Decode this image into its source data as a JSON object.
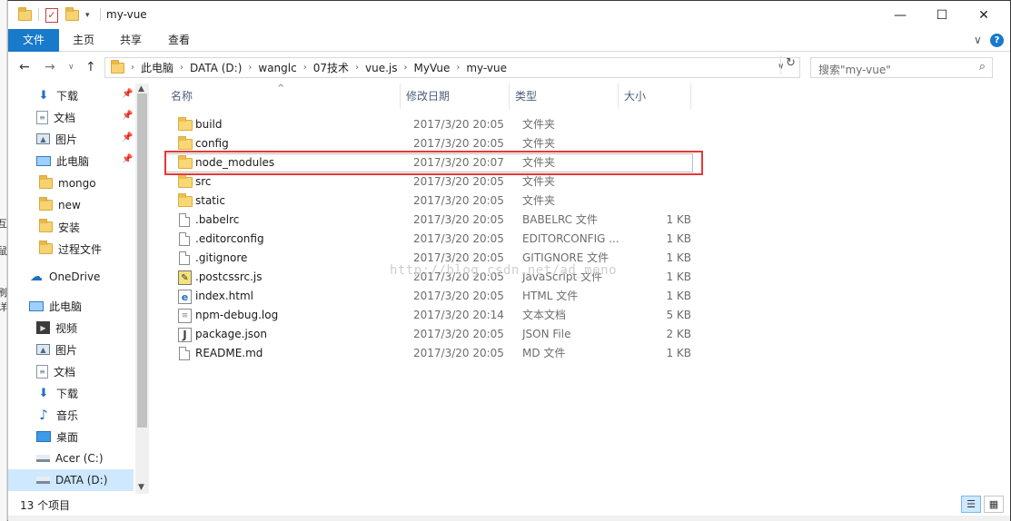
{
  "window": {
    "title": "my-vue"
  },
  "window_controls": {
    "minimize": "—",
    "maximize": "☐",
    "close": "✕"
  },
  "ribbon": {
    "tabs": [
      {
        "label": "文件"
      },
      {
        "label": "主页"
      },
      {
        "label": "共享"
      },
      {
        "label": "查看"
      }
    ],
    "collapse_glyph": "∨",
    "help_glyph": "?"
  },
  "navigation": {
    "back": "←",
    "forward": "→",
    "recent": "∨",
    "up": "↑"
  },
  "address": {
    "crumbs": [
      "此电脑",
      "DATA (D:)",
      "wanglc",
      "07技术",
      "vue.js",
      "MyVue",
      "my-vue"
    ],
    "dropdown_glyph": "∨",
    "refresh_glyph": "↻"
  },
  "search": {
    "placeholder": "搜索\"my-vue\""
  },
  "nav_pane": {
    "items": [
      {
        "label": "下载",
        "icon": "download-icon",
        "pinned": true
      },
      {
        "label": "文档",
        "icon": "document-icon",
        "pinned": true
      },
      {
        "label": "图片",
        "icon": "picture-icon",
        "pinned": true
      },
      {
        "label": "此电脑",
        "icon": "computer-icon",
        "pinned": true
      },
      {
        "label": "mongo",
        "icon": "folder-icon",
        "pinned": false
      },
      {
        "label": "new",
        "icon": "folder-icon",
        "pinned": false
      },
      {
        "label": "安装",
        "icon": "folder-icon",
        "pinned": false
      },
      {
        "label": "过程文件",
        "icon": "folder-icon",
        "pinned": false
      },
      {
        "label": "OneDrive",
        "icon": "cloud-icon",
        "pinned": false
      },
      {
        "label": "此电脑",
        "icon": "computer-icon",
        "pinned": false
      },
      {
        "label": "视频",
        "icon": "video-icon",
        "pinned": false
      },
      {
        "label": "图片",
        "icon": "picture-icon",
        "pinned": false
      },
      {
        "label": "文档",
        "icon": "document-icon",
        "pinned": false
      },
      {
        "label": "下载",
        "icon": "download-icon",
        "pinned": false
      },
      {
        "label": "音乐",
        "icon": "music-icon",
        "pinned": false
      },
      {
        "label": "桌面",
        "icon": "desktop-icon",
        "pinned": false
      },
      {
        "label": "Acer (C:)",
        "icon": "drive-icon",
        "pinned": false
      },
      {
        "label": "DATA (D:)",
        "icon": "drive-icon",
        "pinned": false,
        "selected": true
      }
    ]
  },
  "columns": {
    "name": "名称",
    "date": "修改日期",
    "type": "类型",
    "size": "大小"
  },
  "files": [
    {
      "name": "build",
      "date": "2017/3/20 20:05",
      "type": "文件夹",
      "size": "",
      "icon": "folder-icon"
    },
    {
      "name": "config",
      "date": "2017/3/20 20:05",
      "type": "文件夹",
      "size": "",
      "icon": "folder-icon"
    },
    {
      "name": "node_modules",
      "date": "2017/3/20 20:07",
      "type": "文件夹",
      "size": "",
      "icon": "folder-icon",
      "highlighted": true
    },
    {
      "name": "src",
      "date": "2017/3/20 20:05",
      "type": "文件夹",
      "size": "",
      "icon": "folder-icon"
    },
    {
      "name": "static",
      "date": "2017/3/20 20:05",
      "type": "文件夹",
      "size": "",
      "icon": "folder-icon"
    },
    {
      "name": ".babelrc",
      "date": "2017/3/20 20:05",
      "type": "BABELRC 文件",
      "size": "1 KB",
      "icon": "file-icon"
    },
    {
      "name": ".editorconfig",
      "date": "2017/3/20 20:05",
      "type": "EDITORCONFIG ...",
      "size": "1 KB",
      "icon": "file-icon"
    },
    {
      "name": ".gitignore",
      "date": "2017/3/20 20:05",
      "type": "GITIGNORE 文件",
      "size": "1 KB",
      "icon": "file-icon"
    },
    {
      "name": ".postcssrc.js",
      "date": "2017/3/20 20:05",
      "type": "JavaScript 文件",
      "size": "1 KB",
      "icon": "javascript-icon"
    },
    {
      "name": "index.html",
      "date": "2017/3/20 20:05",
      "type": "HTML 文件",
      "size": "1 KB",
      "icon": "html-icon"
    },
    {
      "name": "npm-debug.log",
      "date": "2017/3/20 20:14",
      "type": "文本文档",
      "size": "5 KB",
      "icon": "text-file-icon"
    },
    {
      "name": "package.json",
      "date": "2017/3/20 20:05",
      "type": "JSON File",
      "size": "2 KB",
      "icon": "json-icon"
    },
    {
      "name": "README.md",
      "date": "2017/3/20 20:05",
      "type": "MD 文件",
      "size": "1 KB",
      "icon": "file-icon"
    }
  ],
  "watermark": "http://blog.csdn.net/ad_meno",
  "status": {
    "item_count": "13 个项目"
  },
  "left_sliver_text": [
    "互",
    "鼠",
    "刷",
    "详"
  ]
}
